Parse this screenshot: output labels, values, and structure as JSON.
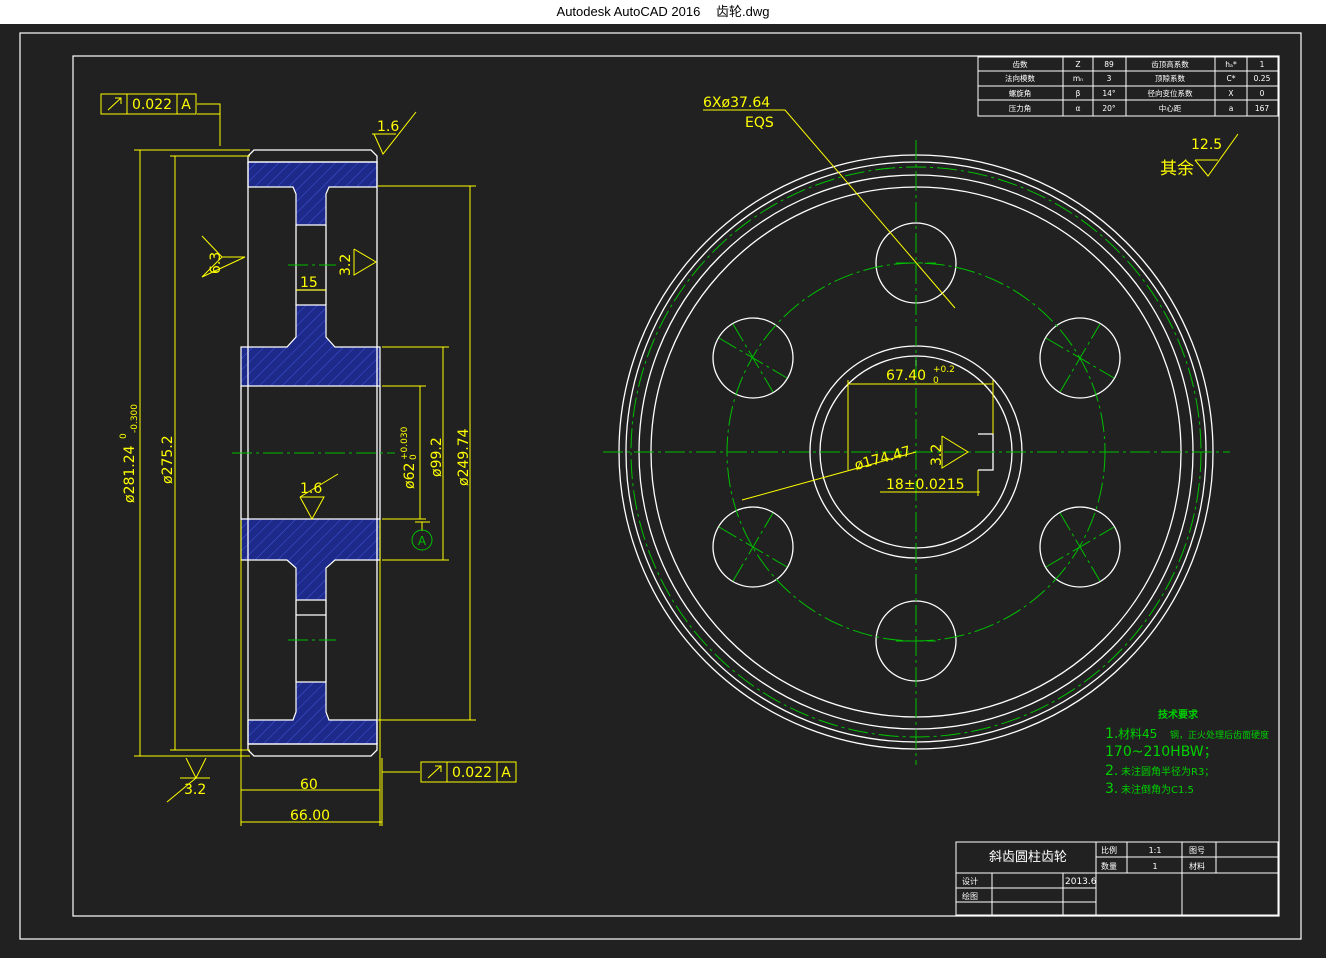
{
  "window": {
    "app_title": "Autodesk AutoCAD 2016",
    "file_name": "齿轮.dwg"
  },
  "colors": {
    "background": "#212121",
    "titlebar": "#ffffff",
    "line_white": "#ffffff",
    "dimension_yellow": "#ffff00",
    "centerline_green": "#00c000",
    "hatch_blue": "#1e2a8a",
    "note_green": "#00d000"
  },
  "params_table": {
    "rows": [
      [
        "齿数",
        "Z",
        "89",
        "齿顶高系数",
        "hₐ*",
        "1"
      ],
      [
        "法向模数",
        "mₙ",
        "3",
        "顶隙系数",
        "C*",
        "0.25"
      ],
      [
        "螺旋角",
        "β",
        "14°",
        "径向变位系数",
        "X",
        "0"
      ],
      [
        "压力角",
        "α",
        "20°",
        "中心距",
        "a",
        "167"
      ]
    ]
  },
  "side_view": {
    "tolerance_top": "0.022",
    "tolerance_top_datum": "A",
    "roughness_top": "1.6",
    "roughness_web_left": "6.3",
    "roughness_web_right": "3.2",
    "web_width": "15",
    "roughness_bore": "1.6",
    "dia_outer_main": "ø281.24",
    "dia_outer_upper": "0",
    "dia_outer_lower": "-0.300",
    "dia_pitch": "ø275.2",
    "dia_bore_main": "ø62",
    "dia_bore_upper": "+0.030",
    "dia_bore_lower": "0",
    "dia_hub": "ø99.2",
    "dia_web": "ø249.74",
    "datum_label": "A",
    "roughness_bottom": "3.2",
    "tolerance_bottom": "0.022",
    "tolerance_bottom_datum": "A",
    "width_inner": "60",
    "width_outer": "66.00"
  },
  "front_view": {
    "holes_label_line1": "6Xø37.64",
    "holes_label_line2": "EQS",
    "roughness_other_label": "其余",
    "roughness_other_value": "12.5",
    "keyway_height_main": "67.40",
    "keyway_height_upper": "+0.2",
    "keyway_height_lower": "0",
    "hole_circle_dia": "ø174.47",
    "roughness_keyway": "3.2",
    "keyway_width": "18±0.0215"
  },
  "tech_notes": {
    "title": "技术要求",
    "line1_prefix": "1.",
    "line1_material": "材料45",
    "line1_rest": "钢，正火处理后齿面硬度",
    "line2": "170~210HBW；",
    "line3_prefix": "2.",
    "line3_text": "未注圆角半径为R3；",
    "line4_prefix": "3.",
    "line4_text": "未注倒角为C1.5"
  },
  "title_block": {
    "part_name": "斜齿圆柱齿轮",
    "scale_label": "比例",
    "scale_value": "1:1",
    "drawing_no_label": "图号",
    "quantity_label": "数量",
    "quantity_value": "1",
    "material_label": "材料",
    "designer_label": "设计",
    "date": "2013.6",
    "drafter_label": "绘图"
  }
}
